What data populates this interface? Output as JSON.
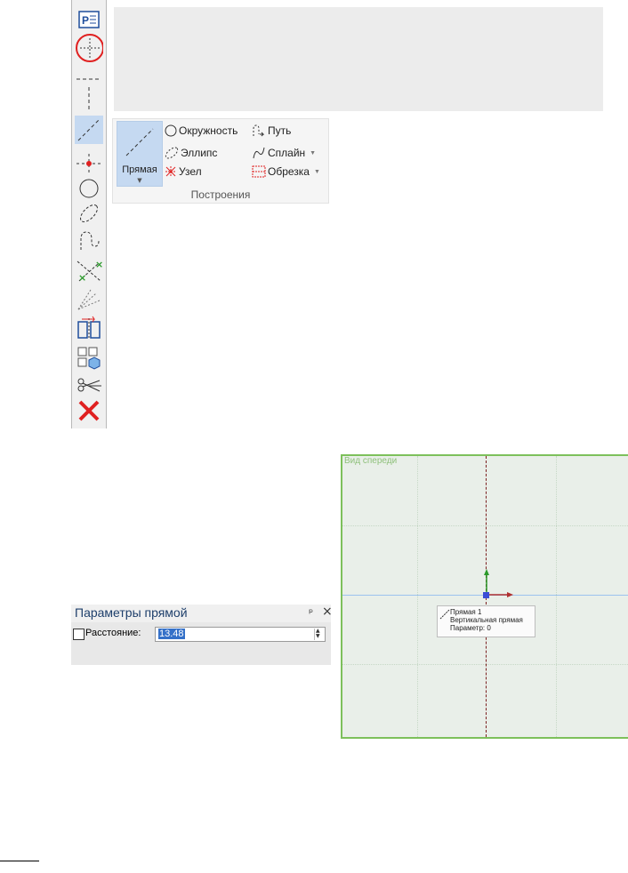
{
  "toolbar": {
    "items": [
      {
        "name": "parameters-icon",
        "active": false
      },
      {
        "name": "crosshair-icon",
        "active": false,
        "highlighted": true
      },
      {
        "name": "horizontal-line-icon",
        "active": false
      },
      {
        "name": "vertical-line-icon",
        "active": false
      },
      {
        "name": "diagonal-line-icon",
        "active": true
      },
      {
        "name": "node-icon",
        "active": false
      },
      {
        "name": "circle-icon",
        "active": false
      },
      {
        "name": "ellipse-icon",
        "active": false
      },
      {
        "name": "path-icon",
        "active": false
      },
      {
        "name": "intersection-icon",
        "active": false
      },
      {
        "name": "hatch-icon",
        "active": false
      },
      {
        "name": "mirror-icon",
        "active": false
      },
      {
        "name": "views-icon",
        "active": false
      },
      {
        "name": "trim-scissors-icon",
        "active": false
      },
      {
        "name": "delete-x-icon",
        "active": false
      }
    ]
  },
  "ribbon": {
    "big_button_label": "Прямая",
    "items": {
      "circle": "Окружность",
      "path": "Путь",
      "ellipse": "Эллипс",
      "spline": "Сплайн",
      "node": "Узел",
      "trim": "Обрезка"
    },
    "group_title": "Построения"
  },
  "params": {
    "title": "Параметры прямой",
    "distance_label": "Расстояние:",
    "distance_value": "13.48",
    "pin": "ᵖ",
    "close": "×"
  },
  "viewport": {
    "view_label": "Вид спереди",
    "tooltip": {
      "line1": "Прямая 1",
      "line2": "Вертикальная прямая",
      "line3": "Параметр: 0"
    }
  },
  "colors": {
    "accent_blue": "#c5d9f1",
    "viewport_border": "#7dc05b",
    "delete_red": "#e02020"
  }
}
